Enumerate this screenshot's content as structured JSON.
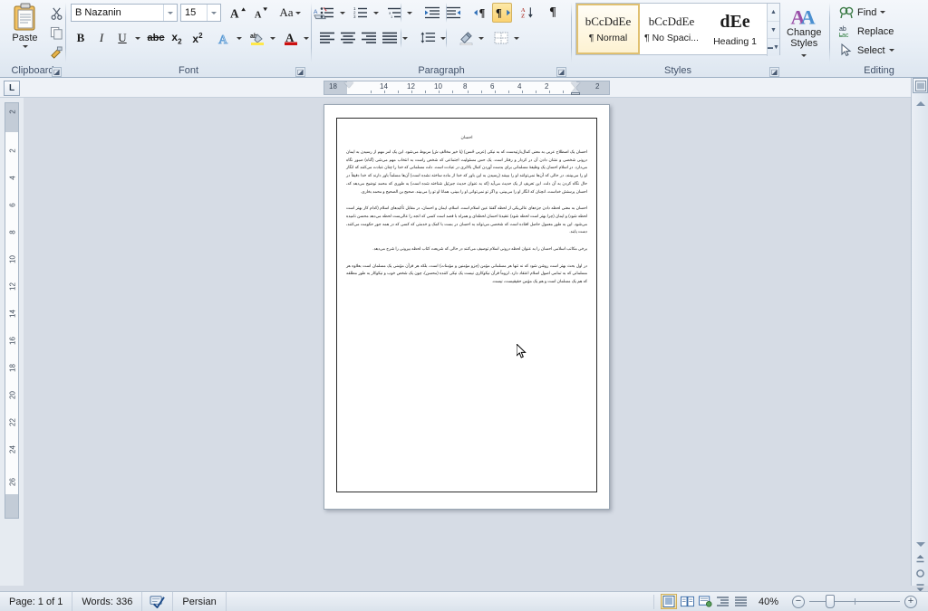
{
  "ribbon": {
    "groups": [
      {
        "id": "clipboard",
        "label": "Clipboard"
      },
      {
        "id": "font",
        "label": "Font"
      },
      {
        "id": "paragraph",
        "label": "Paragraph"
      },
      {
        "id": "styles",
        "label": "Styles"
      },
      {
        "id": "editing",
        "label": "Editing"
      }
    ],
    "clipboard": {
      "paste_label": "Paste",
      "cut_icon": "scissors-icon",
      "copy_icon": "copy-icon",
      "format_painter_icon": "format-painter-icon",
      "dialog_launcher": "clipboard-dialog-launcher"
    },
    "font": {
      "font_name": "B Nazanin",
      "font_size": "15",
      "grow_font": "A",
      "shrink_font": "A",
      "change_case": "Aa",
      "clear_formatting": "clear-formatting-icon",
      "bold": "B",
      "italic": "I",
      "underline": "U",
      "strikethrough": "abc",
      "subscript": "x₂",
      "superscript": "x²",
      "text_effects": "A",
      "highlight": "ab",
      "font_color": "A",
      "dialog_launcher": "font-dialog-launcher"
    },
    "paragraph": {
      "bullets": "bullets-icon",
      "numbering": "numbering-icon",
      "multilevel": "multilevel-list-icon",
      "decrease_indent": "decrease-indent-icon",
      "increase_indent": "increase-indent-icon",
      "ltr_text": "left-to-right-text-icon",
      "rtl_text": "right-to-left-text-icon",
      "rtl_active": true,
      "sort": "sort-icon",
      "show_marks": "show-formatting-marks-icon",
      "align_left": "align-left-icon",
      "align_center": "align-center-icon",
      "align_right": "align-right-icon",
      "align_justify": "align-justify-icon",
      "line_spacing": "line-spacing-icon",
      "shading": "shading-icon",
      "borders": "borders-icon",
      "dialog_launcher": "paragraph-dialog-launcher"
    },
    "styles": {
      "gallery": [
        {
          "preview": "bCcDdEe",
          "name": "¶ Normal",
          "selected": true,
          "heading": false
        },
        {
          "preview": "bCcDdEe",
          "name": "¶ No Spaci...",
          "selected": false,
          "heading": false
        },
        {
          "preview": "dEe",
          "name": "Heading 1",
          "selected": false,
          "heading": true
        }
      ],
      "scroll_up": "▲",
      "scroll_down": "▼",
      "more": "▼",
      "change_styles_line1": "Change",
      "change_styles_line2": "Styles",
      "dialog_launcher": "styles-dialog-launcher"
    },
    "editing": {
      "find": "Find",
      "replace": "Replace",
      "select": "Select"
    }
  },
  "rulers": {
    "tab_selector": "L",
    "horizontal_numbers": [
      "18",
      "14",
      "12",
      "10",
      "8",
      "6",
      "4",
      "2",
      "2"
    ],
    "vertical_numbers": [
      "2",
      "2",
      "4",
      "6",
      "8",
      "10",
      "12",
      "14",
      "16",
      "18",
      "20",
      "22",
      "24",
      "26"
    ]
  },
  "document": {
    "title": "احسان",
    "paragraphs": [
      "احسان یک اصطلاح عربی به معنی کمال‌بارتیه‌ست که به نیکی (عربی حُسن) (یا خیر مخالف ش) مربوط می‌شود. این یک امر مهم از رسیدن به ایمان درونی شخصی و نشان دادن آن در کردار و رفتار است. یک حس مسئولیت اجتماعی که شخص راست به انتخاب مهم می‌شی (گناه) صبور نگاه می‌دارد. در اسلام احسان یک وظیفهٔ مسلمانی برای بدست آوردن کمال بالاتری در عبادت است. دلت مسلمانی که خدا را چنان عبادت می‌کنند که انگار او را می‌بینند، در حالی که آن‌ها نمی‌توانند او را ببینند (رسیدن به این باور که خدا از ماده ساخته نشده است) آن‌ها مسلماً باور دارند که خدا دقیقاً در حال نگاه کردن به آن دلت. این تعریف از یک حدیث می‌آید (که به عنوان حدیث جبرئیل شناخته شده است) به طوری که محمد توضیح می‌دهد که، احسان پرستش خداست، انچنان که انگار او را می‌بینی، و اگر تو نمی‌توانی او را ببینی، همانا او تو را می‌بیند. صحیح بن الصحیح و محمد بخاری.",
      "احسان به معنی لحظه دادن جزءهای عالی‌یکی از لحظه گفتهٔ عین اسلام است. اسلام، ایمان و احسان، در مقابل تأکیدهای اسلام (کدام کار بهتر است لحظه شود) و ایمان (چرا بهتر است لحظه شود) عقیدهٔ احسان لحظه‌ای و همراه با قصد است کسی که انجه را عالی‌ست لحظه می‌دهد محسن نامیده می‌شود. این به طور معمول حاصل افتاده است که شخصی می‌تواند به احسان در بست با کمک و خدمتی که کسی که در همه جور حکومت می‌کنند، دست یابند.",
      "برخی مکاتب اسلامی احسان را به عنوان لحظه درونی اسلام توصیف می‌کنند در حالی که شریعت کتاب لحظه بیرونی را شرح می‌دهد.",
      "در اول بحث بهتر است روشن شود که نه تنها هر مسلمانی مؤمن (جزو مؤمنین و مؤمنات) است، بلکه هر قرآن مؤمنی یک مسلمان است بعلاوه هر مسلمانی که به تمامی اصول اسلام اعتقاد دارد. لزوماً قرآن نیکوکاری نیست یک نیکی کننده (محسن)، چون یک شخص خوب و نیکوکار به طور مطلقه که هم یک مسلمان است و هم یک مؤمن حقیقیست، نیست."
    ]
  },
  "scrollbars": {
    "ruler_toggle": "view-ruler-icon",
    "up_arrow": "scroll-up-arrow",
    "down_arrow": "scroll-down-arrow",
    "previous_page": "previous-page-icon",
    "select_browse_object": "select-browse-object-icon",
    "next_page": "next-page-icon"
  },
  "status": {
    "page": "Page: 1 of 1",
    "words": "Words: 336",
    "proofing_icon": "proofing-errors-icon",
    "language": "Persian",
    "views": [
      {
        "id": "print-layout",
        "icon": "print-layout-icon",
        "selected": true
      },
      {
        "id": "full-screen-reading",
        "icon": "full-screen-reading-icon",
        "selected": false
      },
      {
        "id": "web-layout",
        "icon": "web-layout-icon",
        "selected": false
      },
      {
        "id": "outline",
        "icon": "outline-icon",
        "selected": false
      },
      {
        "id": "draft",
        "icon": "draft-icon",
        "selected": false
      }
    ],
    "zoom": "40%",
    "zoom_out": "−",
    "zoom_in": "+"
  },
  "colors": {
    "ribbon_bg": "#eaf0f7",
    "accent_highlight": "#fbd271",
    "status_bg": "#dbe3ec",
    "canvas_bg": "#d6dce5",
    "page_bg": "#ffffff"
  }
}
